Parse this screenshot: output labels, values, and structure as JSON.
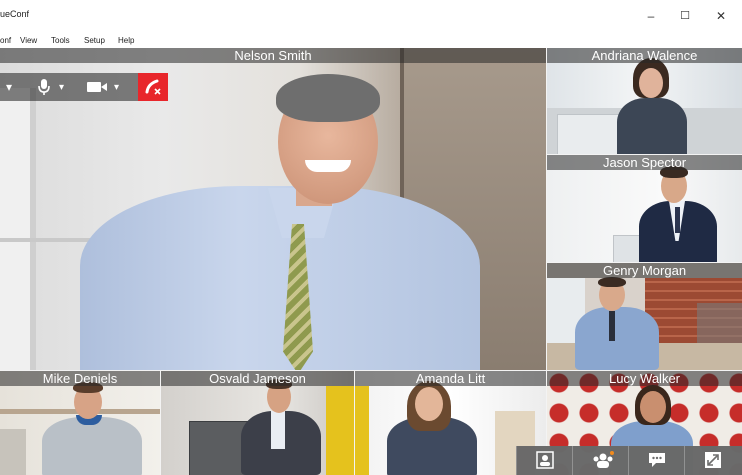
{
  "window": {
    "title": "ueConf",
    "minimize": "–",
    "maximize": "☐",
    "close": "✕"
  },
  "menu": [
    "onf",
    "View",
    "Tools",
    "Setup",
    "Help"
  ],
  "participants": {
    "main": "Nelson Smith",
    "side": [
      "Andriana Walence",
      "Jason Spector",
      "Genry Morgan"
    ],
    "bottom": [
      "Mike Deniels",
      "Osvald Jameson",
      "Amanda Litt",
      "Lucy Walker"
    ]
  },
  "call_controls": {
    "dropdown_glyph": "▾",
    "icons": [
      "share-icon",
      "microphone-icon",
      "camera-icon",
      "end-call-icon"
    ]
  },
  "bottom_toolbar": {
    "icons": [
      "contact-card-icon",
      "participants-icon",
      "chat-icon",
      "fullscreen-icon"
    ]
  },
  "colors": {
    "end_call": "#e8262b",
    "name_overlay": "#282828",
    "notification_dot": "#f28b1d"
  }
}
